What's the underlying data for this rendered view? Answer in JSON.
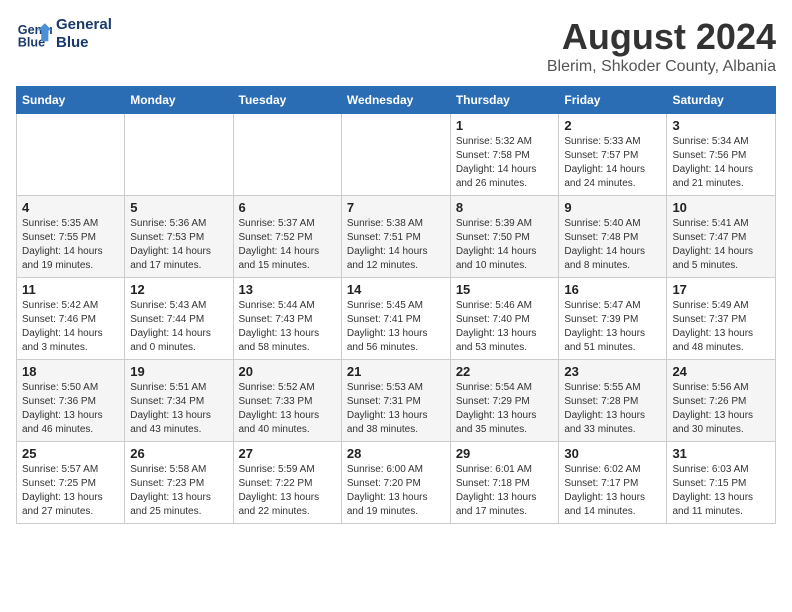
{
  "header": {
    "logo_line1": "General",
    "logo_line2": "Blue",
    "title": "August 2024",
    "subtitle": "Blerim, Shkoder County, Albania"
  },
  "days_of_week": [
    "Sunday",
    "Monday",
    "Tuesday",
    "Wednesday",
    "Thursday",
    "Friday",
    "Saturday"
  ],
  "weeks": [
    [
      {
        "num": "",
        "info": ""
      },
      {
        "num": "",
        "info": ""
      },
      {
        "num": "",
        "info": ""
      },
      {
        "num": "",
        "info": ""
      },
      {
        "num": "1",
        "info": "Sunrise: 5:32 AM\nSunset: 7:58 PM\nDaylight: 14 hours\nand 26 minutes."
      },
      {
        "num": "2",
        "info": "Sunrise: 5:33 AM\nSunset: 7:57 PM\nDaylight: 14 hours\nand 24 minutes."
      },
      {
        "num": "3",
        "info": "Sunrise: 5:34 AM\nSunset: 7:56 PM\nDaylight: 14 hours\nand 21 minutes."
      }
    ],
    [
      {
        "num": "4",
        "info": "Sunrise: 5:35 AM\nSunset: 7:55 PM\nDaylight: 14 hours\nand 19 minutes."
      },
      {
        "num": "5",
        "info": "Sunrise: 5:36 AM\nSunset: 7:53 PM\nDaylight: 14 hours\nand 17 minutes."
      },
      {
        "num": "6",
        "info": "Sunrise: 5:37 AM\nSunset: 7:52 PM\nDaylight: 14 hours\nand 15 minutes."
      },
      {
        "num": "7",
        "info": "Sunrise: 5:38 AM\nSunset: 7:51 PM\nDaylight: 14 hours\nand 12 minutes."
      },
      {
        "num": "8",
        "info": "Sunrise: 5:39 AM\nSunset: 7:50 PM\nDaylight: 14 hours\nand 10 minutes."
      },
      {
        "num": "9",
        "info": "Sunrise: 5:40 AM\nSunset: 7:48 PM\nDaylight: 14 hours\nand 8 minutes."
      },
      {
        "num": "10",
        "info": "Sunrise: 5:41 AM\nSunset: 7:47 PM\nDaylight: 14 hours\nand 5 minutes."
      }
    ],
    [
      {
        "num": "11",
        "info": "Sunrise: 5:42 AM\nSunset: 7:46 PM\nDaylight: 14 hours\nand 3 minutes."
      },
      {
        "num": "12",
        "info": "Sunrise: 5:43 AM\nSunset: 7:44 PM\nDaylight: 14 hours\nand 0 minutes."
      },
      {
        "num": "13",
        "info": "Sunrise: 5:44 AM\nSunset: 7:43 PM\nDaylight: 13 hours\nand 58 minutes."
      },
      {
        "num": "14",
        "info": "Sunrise: 5:45 AM\nSunset: 7:41 PM\nDaylight: 13 hours\nand 56 minutes."
      },
      {
        "num": "15",
        "info": "Sunrise: 5:46 AM\nSunset: 7:40 PM\nDaylight: 13 hours\nand 53 minutes."
      },
      {
        "num": "16",
        "info": "Sunrise: 5:47 AM\nSunset: 7:39 PM\nDaylight: 13 hours\nand 51 minutes."
      },
      {
        "num": "17",
        "info": "Sunrise: 5:49 AM\nSunset: 7:37 PM\nDaylight: 13 hours\nand 48 minutes."
      }
    ],
    [
      {
        "num": "18",
        "info": "Sunrise: 5:50 AM\nSunset: 7:36 PM\nDaylight: 13 hours\nand 46 minutes."
      },
      {
        "num": "19",
        "info": "Sunrise: 5:51 AM\nSunset: 7:34 PM\nDaylight: 13 hours\nand 43 minutes."
      },
      {
        "num": "20",
        "info": "Sunrise: 5:52 AM\nSunset: 7:33 PM\nDaylight: 13 hours\nand 40 minutes."
      },
      {
        "num": "21",
        "info": "Sunrise: 5:53 AM\nSunset: 7:31 PM\nDaylight: 13 hours\nand 38 minutes."
      },
      {
        "num": "22",
        "info": "Sunrise: 5:54 AM\nSunset: 7:29 PM\nDaylight: 13 hours\nand 35 minutes."
      },
      {
        "num": "23",
        "info": "Sunrise: 5:55 AM\nSunset: 7:28 PM\nDaylight: 13 hours\nand 33 minutes."
      },
      {
        "num": "24",
        "info": "Sunrise: 5:56 AM\nSunset: 7:26 PM\nDaylight: 13 hours\nand 30 minutes."
      }
    ],
    [
      {
        "num": "25",
        "info": "Sunrise: 5:57 AM\nSunset: 7:25 PM\nDaylight: 13 hours\nand 27 minutes."
      },
      {
        "num": "26",
        "info": "Sunrise: 5:58 AM\nSunset: 7:23 PM\nDaylight: 13 hours\nand 25 minutes."
      },
      {
        "num": "27",
        "info": "Sunrise: 5:59 AM\nSunset: 7:22 PM\nDaylight: 13 hours\nand 22 minutes."
      },
      {
        "num": "28",
        "info": "Sunrise: 6:00 AM\nSunset: 7:20 PM\nDaylight: 13 hours\nand 19 minutes."
      },
      {
        "num": "29",
        "info": "Sunrise: 6:01 AM\nSunset: 7:18 PM\nDaylight: 13 hours\nand 17 minutes."
      },
      {
        "num": "30",
        "info": "Sunrise: 6:02 AM\nSunset: 7:17 PM\nDaylight: 13 hours\nand 14 minutes."
      },
      {
        "num": "31",
        "info": "Sunrise: 6:03 AM\nSunset: 7:15 PM\nDaylight: 13 hours\nand 11 minutes."
      }
    ]
  ]
}
